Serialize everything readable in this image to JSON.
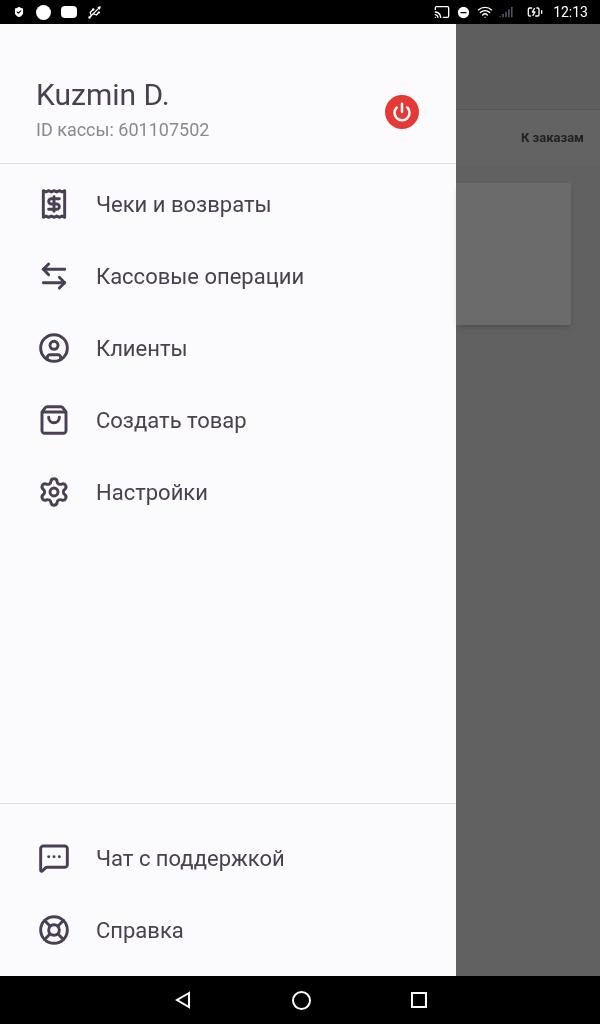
{
  "status_bar": {
    "time": "12:13"
  },
  "drawer": {
    "user_name": "Kuzmin D.",
    "register_id": "ID кассы: 601107502",
    "menu": [
      {
        "label": "Чеки и возвраты"
      },
      {
        "label": "Кассовые операции"
      },
      {
        "label": "Клиенты"
      },
      {
        "label": "Создать товар"
      },
      {
        "label": "Настройки"
      }
    ],
    "footer_menu": [
      {
        "label": "Чат с поддержкой"
      },
      {
        "label": "Справка"
      }
    ]
  },
  "background": {
    "orders_button": "К заказам"
  }
}
